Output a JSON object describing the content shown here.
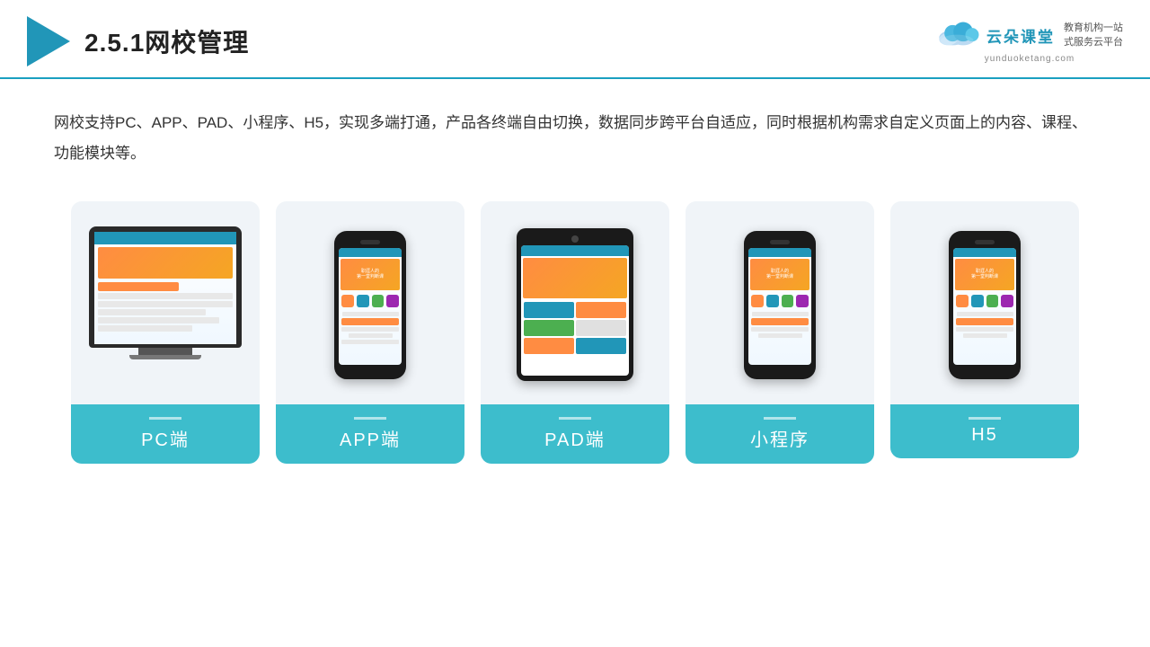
{
  "header": {
    "title": "2.5.1网校管理",
    "logo_cn": "云朵课堂",
    "logo_en": "yunduoketang.com",
    "tagline_line1": "教育机构一站",
    "tagline_line2": "式服务云平台"
  },
  "description": "网校支持PC、APP、PAD、小程序、H5，实现多端打通，产品各终端自由切换，数据同步跨平台自适应，同时根据机构需求自定义页面上的内容、课程、功能模块等。",
  "cards": [
    {
      "id": "pc",
      "label": "PC端"
    },
    {
      "id": "app",
      "label": "APP端"
    },
    {
      "id": "pad",
      "label": "PAD端"
    },
    {
      "id": "miniapp",
      "label": "小程序"
    },
    {
      "id": "h5",
      "label": "H5"
    }
  ]
}
